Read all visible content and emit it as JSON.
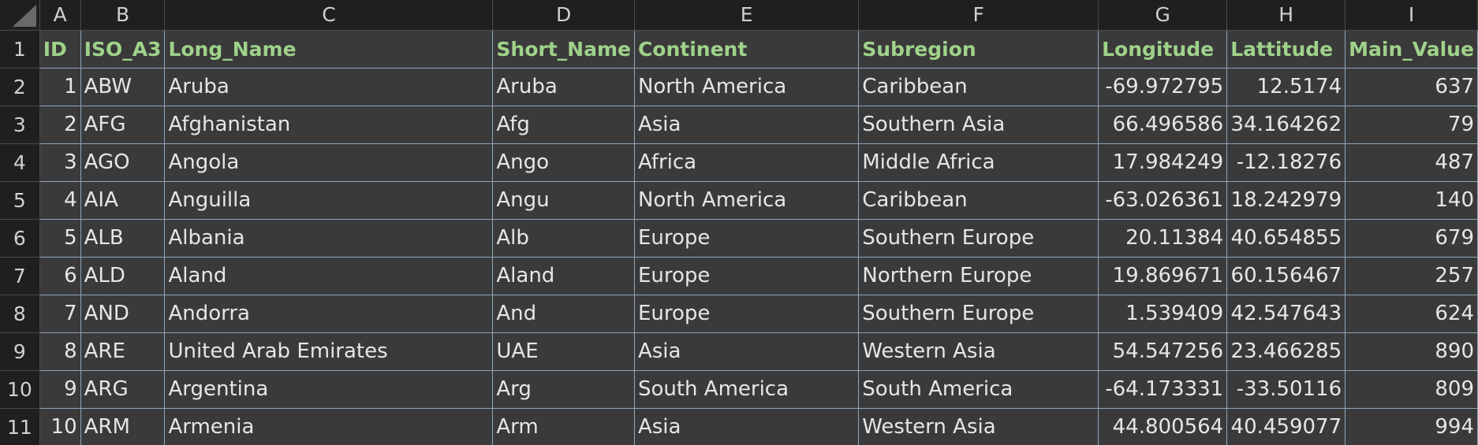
{
  "spreadsheet": {
    "column_letters": [
      "A",
      "B",
      "C",
      "D",
      "E",
      "F",
      "G",
      "H",
      "I"
    ],
    "row_numbers": [
      "1",
      "2",
      "3",
      "4",
      "5",
      "6",
      "7",
      "8",
      "9",
      "10",
      "11"
    ],
    "headers": [
      "ID",
      "ISO_A3",
      "Long_Name",
      "Short_Name",
      "Continent",
      "Subregion",
      "Longitude",
      "Lattitude",
      "Main_Value"
    ],
    "rows": [
      [
        "1",
        "ABW",
        "Aruba",
        "Aruba",
        "North America",
        "Caribbean",
        "-69.972795",
        "12.5174",
        "637"
      ],
      [
        "2",
        "AFG",
        "Afghanistan",
        "Afg",
        "Asia",
        "Southern Asia",
        "66.496586",
        "34.164262",
        "79"
      ],
      [
        "3",
        "AGO",
        "Angola",
        "Ango",
        "Africa",
        "Middle Africa",
        "17.984249",
        "-12.18276",
        "487"
      ],
      [
        "4",
        "AIA",
        "Anguilla",
        "Angu",
        "North America",
        "Caribbean",
        "-63.026361",
        "18.242979",
        "140"
      ],
      [
        "5",
        "ALB",
        "Albania",
        "Alb",
        "Europe",
        "Southern Europe",
        "20.11384",
        "40.654855",
        "679"
      ],
      [
        "6",
        "ALD",
        "Aland",
        "Aland",
        "Europe",
        "Northern Europe",
        "19.869671",
        "60.156467",
        "257"
      ],
      [
        "7",
        "AND",
        "Andorra",
        "And",
        "Europe",
        "Southern Europe",
        "1.539409",
        "42.547643",
        "624"
      ],
      [
        "8",
        "ARE",
        "United Arab Emirates",
        "UAE",
        "Asia",
        "Western Asia",
        "54.547256",
        "23.466285",
        "890"
      ],
      [
        "9",
        "ARG",
        "Argentina",
        "Arg",
        "South America",
        "South America",
        "-64.173331",
        "-33.50116",
        "809"
      ],
      [
        "10",
        "ARM",
        "Armenia",
        "Arm",
        "Asia",
        "Western Asia",
        "44.800564",
        "40.459077",
        "994"
      ]
    ]
  },
  "colors": {
    "background": "#1f1f1f",
    "cell": "#3a3a3a",
    "gridline": "#8fa6bb",
    "header_text": "#9fd28a"
  }
}
